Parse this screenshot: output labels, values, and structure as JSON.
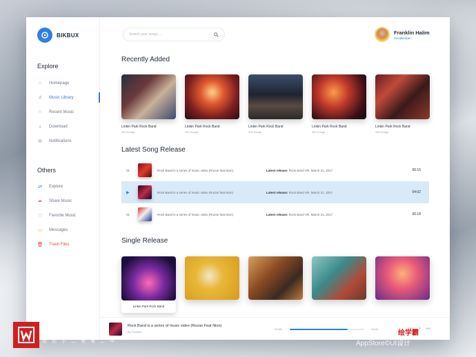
{
  "brand": {
    "name": "BIKBUX"
  },
  "sidebar": {
    "explore_title": "Explore",
    "explore_items": [
      {
        "label": "Homepage",
        "icon": "home-icon"
      },
      {
        "label": "Music Library",
        "icon": "music-note-icon",
        "active": true
      },
      {
        "label": "Recent Music",
        "icon": "headphones-icon"
      },
      {
        "label": "Download",
        "icon": "download-icon"
      },
      {
        "label": "Notifications",
        "icon": "gear-icon"
      }
    ],
    "others_title": "Others",
    "others_items": [
      {
        "label": "Explore",
        "icon": "shuffle-icon"
      },
      {
        "label": "Share Music",
        "icon": "share-icon"
      },
      {
        "label": "Favorite Music",
        "icon": "heart-icon"
      },
      {
        "label": "Messages",
        "icon": "message-icon"
      },
      {
        "label": "Trash Files",
        "icon": "trash-icon"
      }
    ]
  },
  "search": {
    "placeholder": "Search your songs ..."
  },
  "user": {
    "name": "Franklin Halim",
    "role": "Vocalkeeper"
  },
  "recently_added": {
    "title": "Recently Added",
    "cards": [
      {
        "title": "Linkin Park Rock Band",
        "songs": "450 Songs"
      },
      {
        "title": "Linkin Park Rock Band",
        "songs": "450 Songs"
      },
      {
        "title": "Linkin Park Rock Band",
        "songs": "450 Songs"
      },
      {
        "title": "Linkin Park Rock Band",
        "songs": "450 Songs"
      },
      {
        "title": "Linkin Park Rock Band",
        "songs": "450 Songs"
      }
    ]
  },
  "latest_release": {
    "title": "Latest Song Release",
    "rows": [
      {
        "num": "01",
        "title": "Rock Band is a series of music video (Rozan feat Nion)",
        "release_label": "Latest release:",
        "release_value": "Rock Band VR, March 21, 2017",
        "duration": "06:15"
      },
      {
        "num": "",
        "title": "Rock Band is a series of music video (Rozan feat Nion)",
        "release_label": "Latest release:",
        "release_value": "Rock Band VR, March 21, 2017",
        "duration": "04:02",
        "active": true
      },
      {
        "num": "01",
        "title": "Rock Band is a series of music video (Rozan feat Nion)",
        "release_label": "Latest release:",
        "release_value": "Rock Band VR, March 21, 2017",
        "duration": "06:18"
      }
    ]
  },
  "single_release": {
    "title": "Single Release",
    "first_caption": "Linkin Park Rock Band"
  },
  "player": {
    "title": "Rock Band is a series of music video (Rozan Feat Nion)",
    "by": "By Franklin",
    "elapsed": "-00:58",
    "total": "-04:02",
    "progress": 0.78
  },
  "watermark": {
    "left_main": "王氏教育集",
    "left_sub": "始创于二零零二年",
    "right_red": "绘学霸",
    "right_text": "AppStore©UI设计"
  },
  "colors": {
    "accent": "#2f7ee6",
    "danger": "#e04a4a",
    "active_row": "#d8eaf7"
  }
}
